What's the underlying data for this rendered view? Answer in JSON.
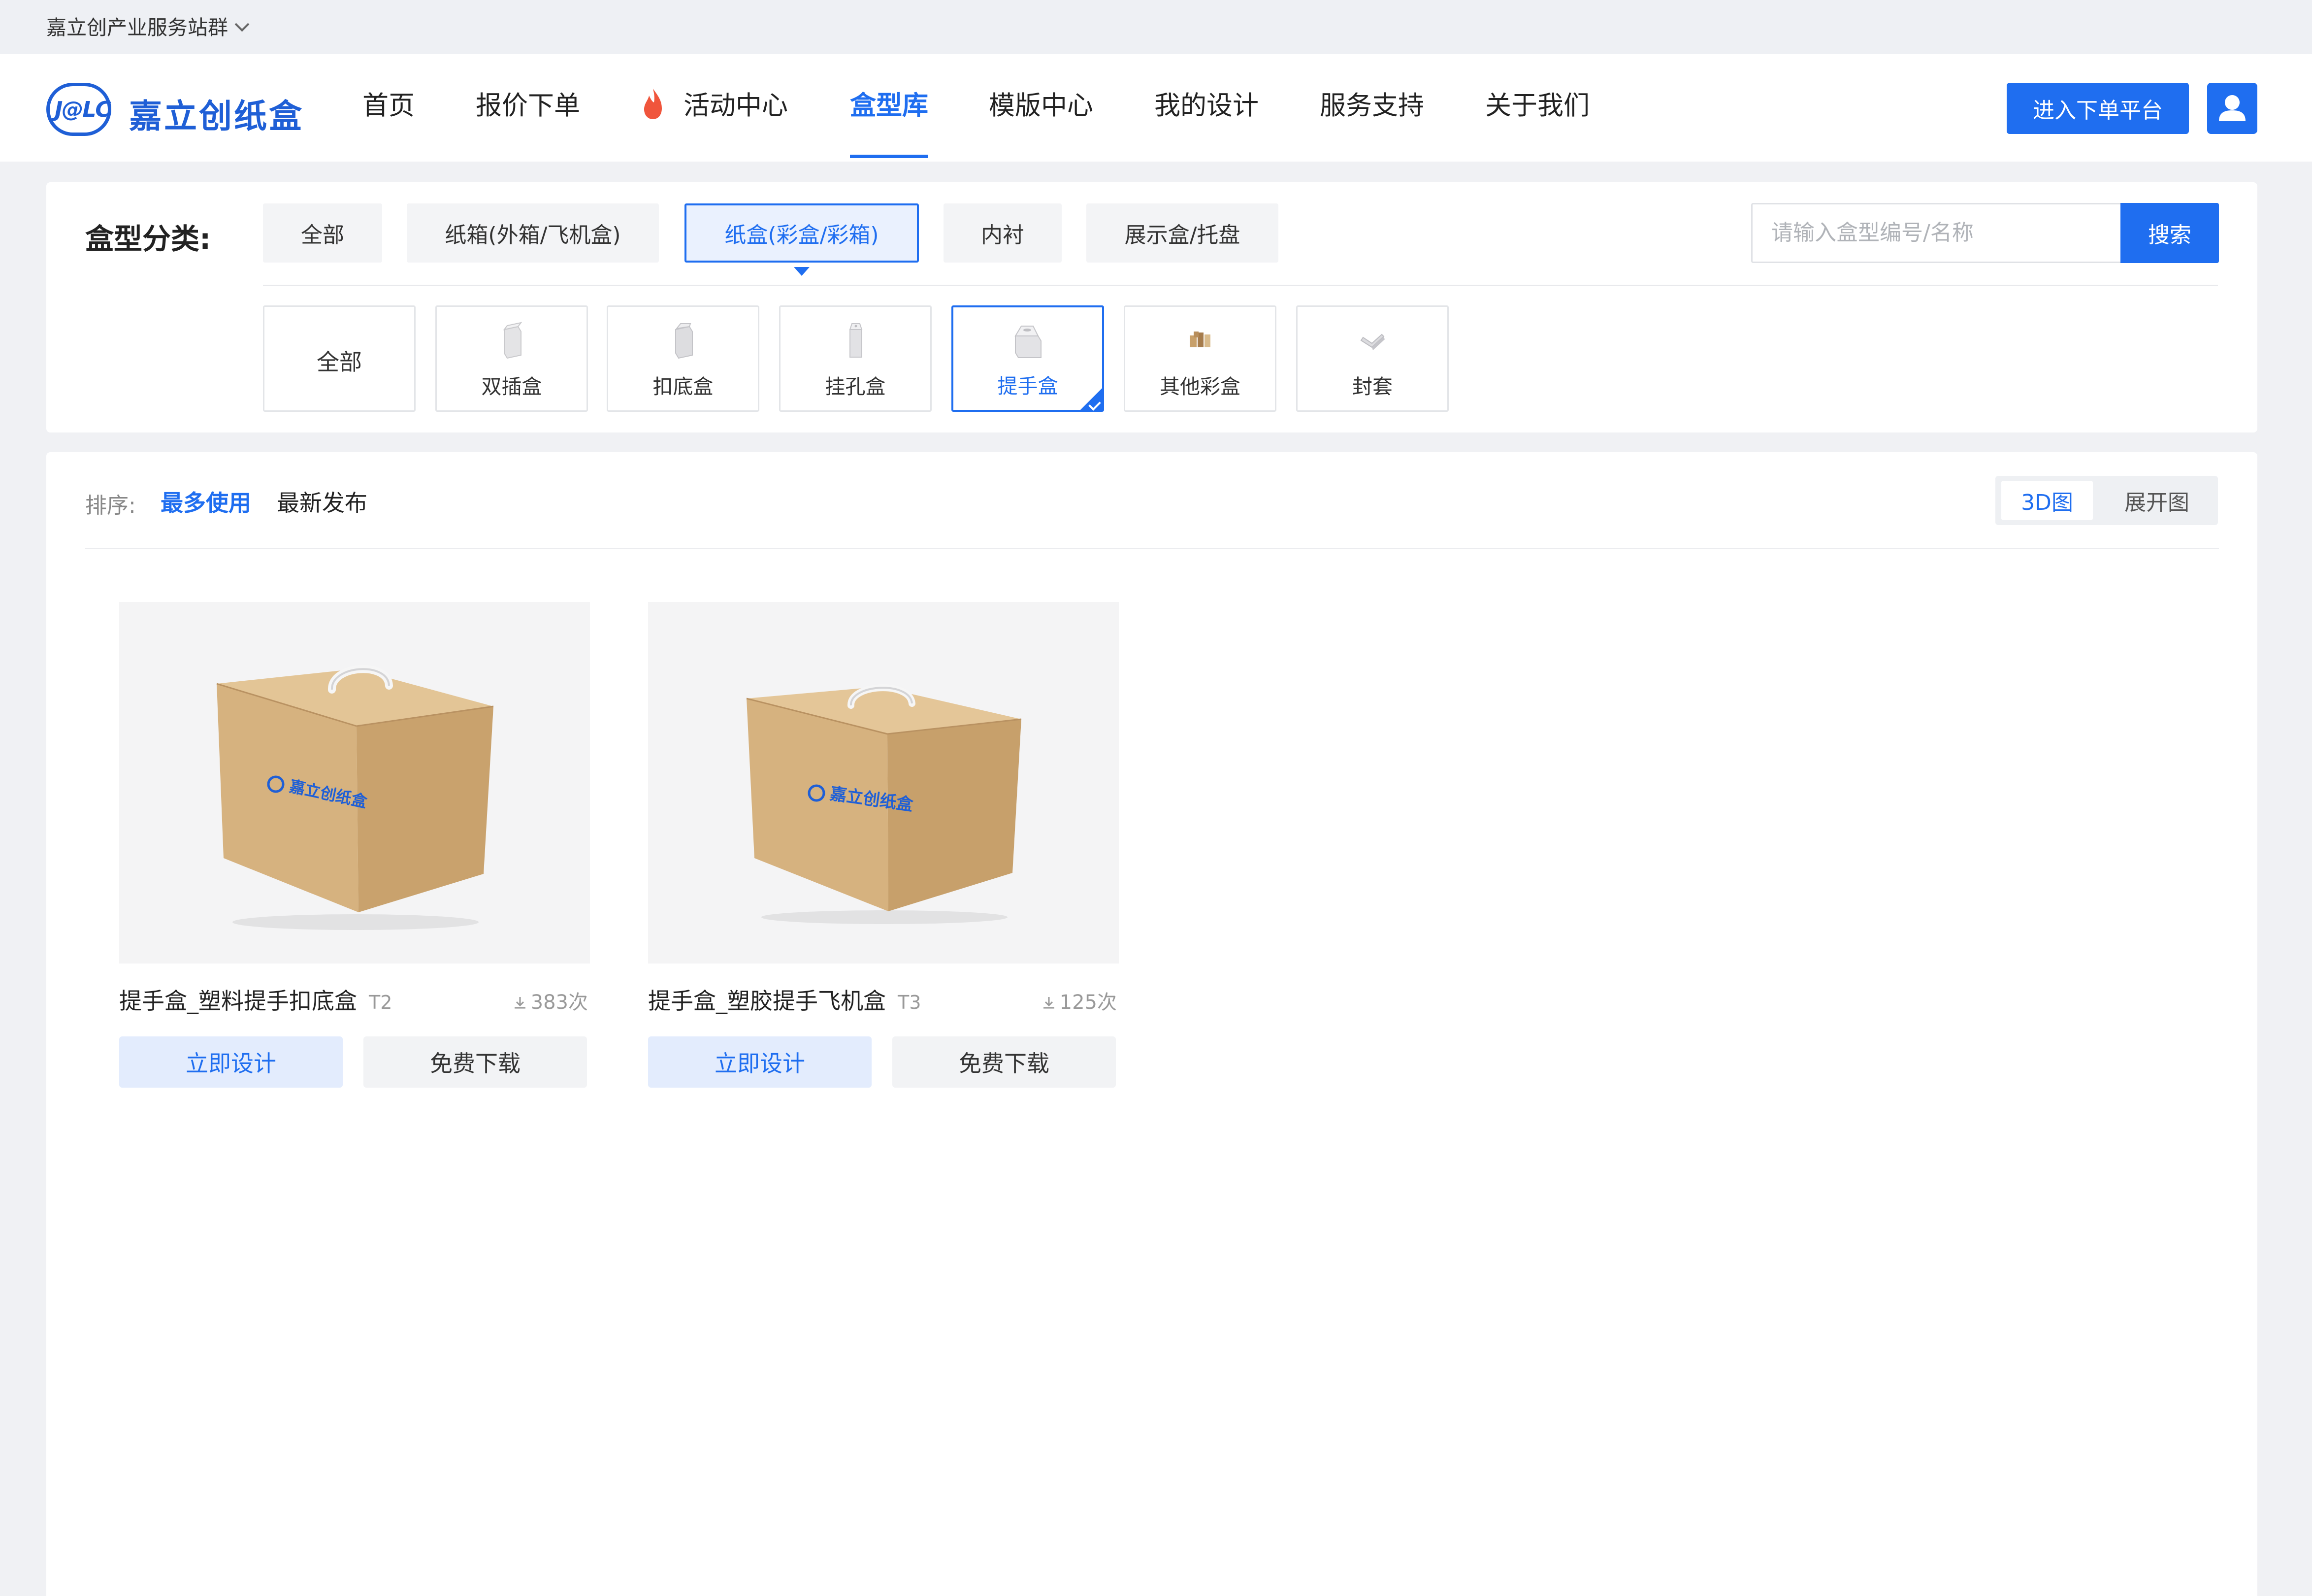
{
  "site_switch": {
    "label": "嘉立创产业服务站群"
  },
  "brand": {
    "mark": "J@LC",
    "name": "嘉立创纸盒",
    "color": "#1f5fd6"
  },
  "nav": {
    "items": [
      {
        "label": "首页"
      },
      {
        "label": "报价下单"
      },
      {
        "label": "活动中心",
        "icon": "flame-icon"
      },
      {
        "label": "盒型库",
        "active": true
      },
      {
        "label": "模版中心"
      },
      {
        "label": "我的设计"
      },
      {
        "label": "服务支持"
      },
      {
        "label": "关于我们"
      }
    ],
    "enter_button": "进入下单平台",
    "user_icon": "user-icon"
  },
  "category": {
    "label": "盒型分类:",
    "tabs": [
      {
        "label": "全部"
      },
      {
        "label": "纸箱(外箱/飞机盒)"
      },
      {
        "label": "纸盒(彩盒/彩箱)",
        "active": true
      },
      {
        "label": "内衬"
      },
      {
        "label": "展示盒/托盘"
      }
    ],
    "search": {
      "placeholder": "请输入盒型编号/名称",
      "button": "搜索"
    },
    "sub_tabs": [
      {
        "label": "全部"
      },
      {
        "label": "双插盒",
        "icon": "tuck-box-icon"
      },
      {
        "label": "扣底盒",
        "icon": "lock-bottom-box-icon"
      },
      {
        "label": "挂孔盒",
        "icon": "hang-box-icon"
      },
      {
        "label": "提手盒",
        "icon": "handle-box-icon",
        "active": true
      },
      {
        "label": "其他彩盒",
        "icon": "other-box-icon"
      },
      {
        "label": "封套",
        "icon": "sleeve-icon"
      }
    ]
  },
  "sort": {
    "label": "排序:",
    "options": [
      {
        "label": "最多使用",
        "active": true
      },
      {
        "label": "最新发布"
      }
    ],
    "views": [
      {
        "label": "3D图",
        "active": true
      },
      {
        "label": "展开图"
      }
    ]
  },
  "products": [
    {
      "title": "提手盒_塑料提手扣底盒",
      "code": "T2",
      "downloads": "383次",
      "design_button": "立即设计",
      "download_button": "免费下载",
      "box_print": "嘉立创纸盒"
    },
    {
      "title": "提手盒_塑胶提手飞机盒",
      "code": "T3",
      "downloads": "125次",
      "design_button": "立即设计",
      "download_button": "免费下载",
      "box_print": "嘉立创纸盒"
    }
  ],
  "colors": {
    "accent": "#1f6ef0",
    "box": "#d8b482"
  }
}
